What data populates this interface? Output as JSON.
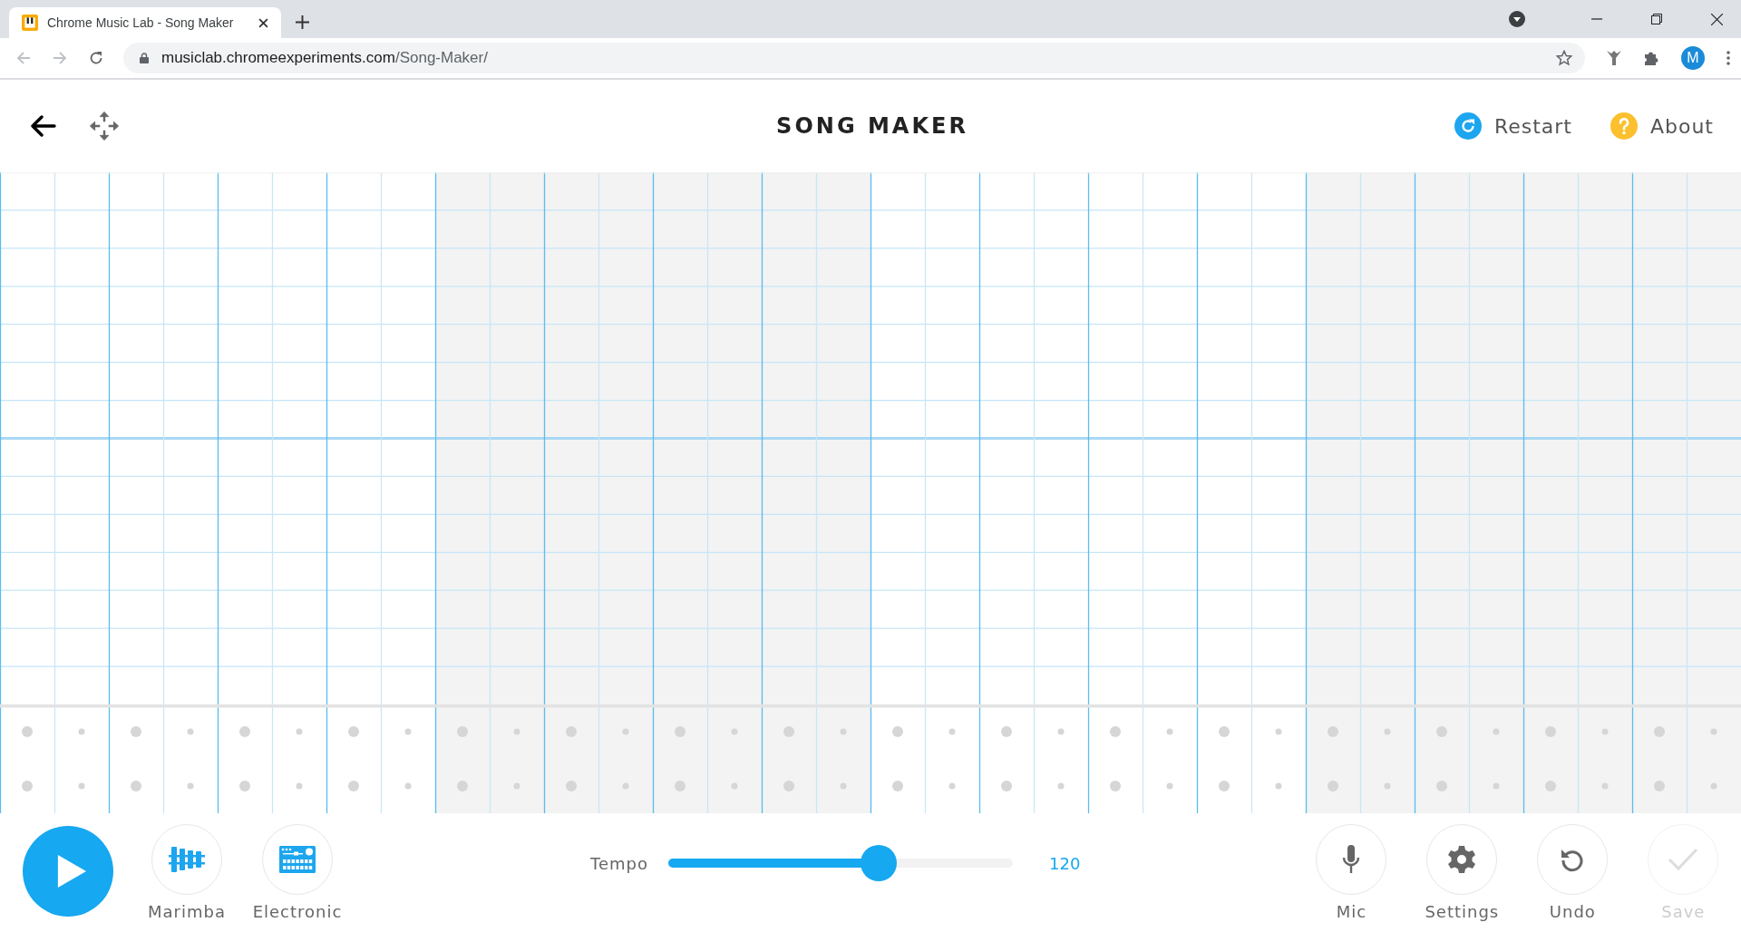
{
  "browser": {
    "tabs": [
      {
        "title": "Chrome Music Lab - Song Maker",
        "selected": true
      }
    ],
    "address": {
      "host": "musiclab.chromeexperiments.com",
      "path": "/Song-Maker/"
    },
    "profile_initial": "M"
  },
  "header": {
    "title": "SONG MAKER",
    "actions": [
      {
        "label": "Restart",
        "kind": "restart"
      },
      {
        "label": "About",
        "kind": "about"
      }
    ]
  },
  "toolbar": {
    "instruments": [
      {
        "label": "Marimba",
        "kind": "marimba"
      },
      {
        "label": "Electronic",
        "kind": "electronic"
      }
    ],
    "tempo": {
      "label": "Tempo",
      "level": 0.61,
      "reading": "120"
    },
    "tools": [
      {
        "label": "Mic",
        "kind": "mic",
        "disabled": false
      },
      {
        "label": "Settings",
        "kind": "settings",
        "disabled": false
      },
      {
        "label": "Undo",
        "kind": "undo",
        "disabled": false
      },
      {
        "label": "Save",
        "kind": "save",
        "disabled": true
      }
    ]
  }
}
